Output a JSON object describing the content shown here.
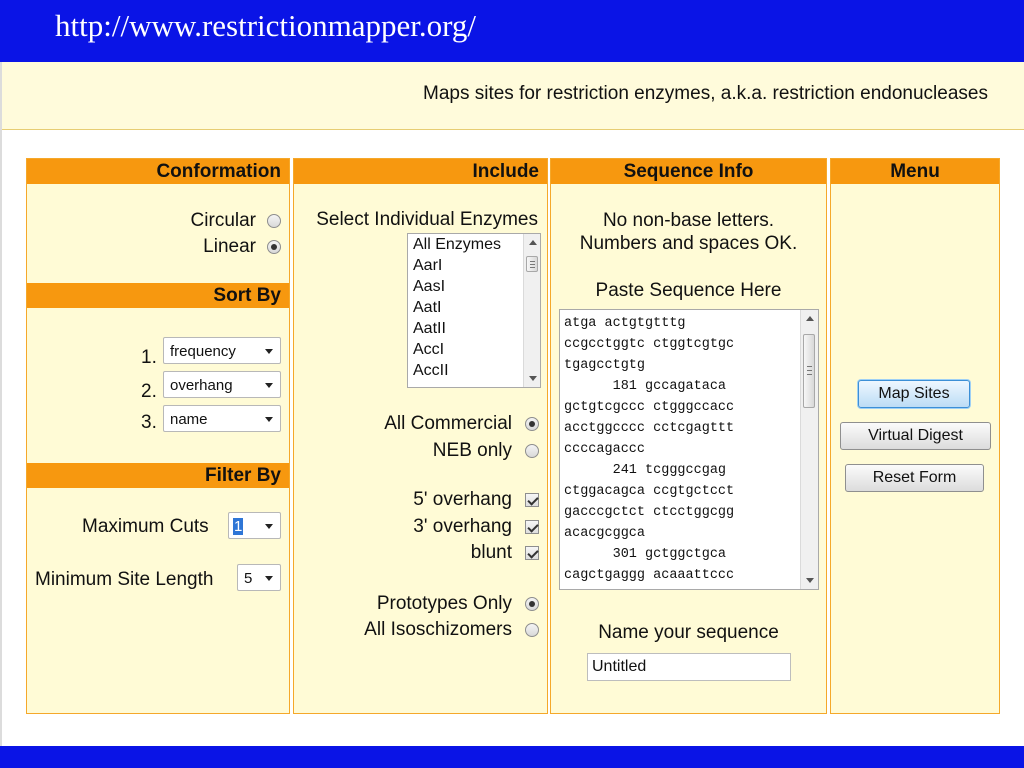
{
  "slide": {
    "title": "http://www.restrictionmapper.org/"
  },
  "banner": {
    "tagline": "Maps sites for restriction enzymes, a.k.a. restriction endonucleases"
  },
  "conformation": {
    "header": "Conformation",
    "options": [
      {
        "label": "Circular",
        "selected": false
      },
      {
        "label": "Linear",
        "selected": true
      }
    ]
  },
  "sort_by": {
    "header": "Sort By",
    "rows": [
      {
        "number": "1.",
        "value": "frequency"
      },
      {
        "number": "2.",
        "value": "overhang"
      },
      {
        "number": "3.",
        "value": "name"
      }
    ]
  },
  "filter_by": {
    "header": "Filter By",
    "max_cuts_label": "Maximum Cuts",
    "max_cuts_value": "1",
    "min_site_label": "Minimum Site Length",
    "min_site_value": "5"
  },
  "include": {
    "header": "Include",
    "select_label": "Select Individual Enzymes",
    "enzymes": [
      "All Enzymes",
      "AarI",
      "AasI",
      "AatI",
      "AatII",
      "AccI",
      "AccII"
    ],
    "source_options": [
      {
        "label": "All Commercial",
        "selected": true
      },
      {
        "label": "NEB only",
        "selected": false
      }
    ],
    "end_options": [
      {
        "label": "5' overhang",
        "checked": true
      },
      {
        "label": "3' overhang",
        "checked": true
      },
      {
        "label": "blunt",
        "checked": true
      }
    ],
    "iso_options": [
      {
        "label": "Prototypes Only",
        "selected": true
      },
      {
        "label": "All Isoschizomers",
        "selected": false
      }
    ]
  },
  "sequence_info": {
    "header": "Sequence Info",
    "note_line1": "No non-base letters.",
    "note_line2": "Numbers and spaces OK.",
    "paste_label": "Paste Sequence Here",
    "sequence_lines": [
      "atga actgtgtttg",
      "ccgcctggtc ctggtcgtgc",
      "tgagcctgtg",
      "      181 gccagataca",
      "gctgtcgccc ctgggccacc",
      "acctggcccc cctcgagttt",
      "ccccagaccc",
      "      241 tcgggccgag",
      "ctggacagca ccgtgctcct",
      "gacccgctct ctcctggcgg",
      "acacgcggca",
      "      301 gctggctgca",
      "cagctgaggg acaaattccc"
    ],
    "name_label": "Name your sequence",
    "name_value": "Untitled"
  },
  "menu": {
    "header": "Menu",
    "buttons": {
      "map_sites": "Map Sites",
      "virtual_digest": "Virtual Digest",
      "reset_form": "Reset Form"
    }
  }
}
